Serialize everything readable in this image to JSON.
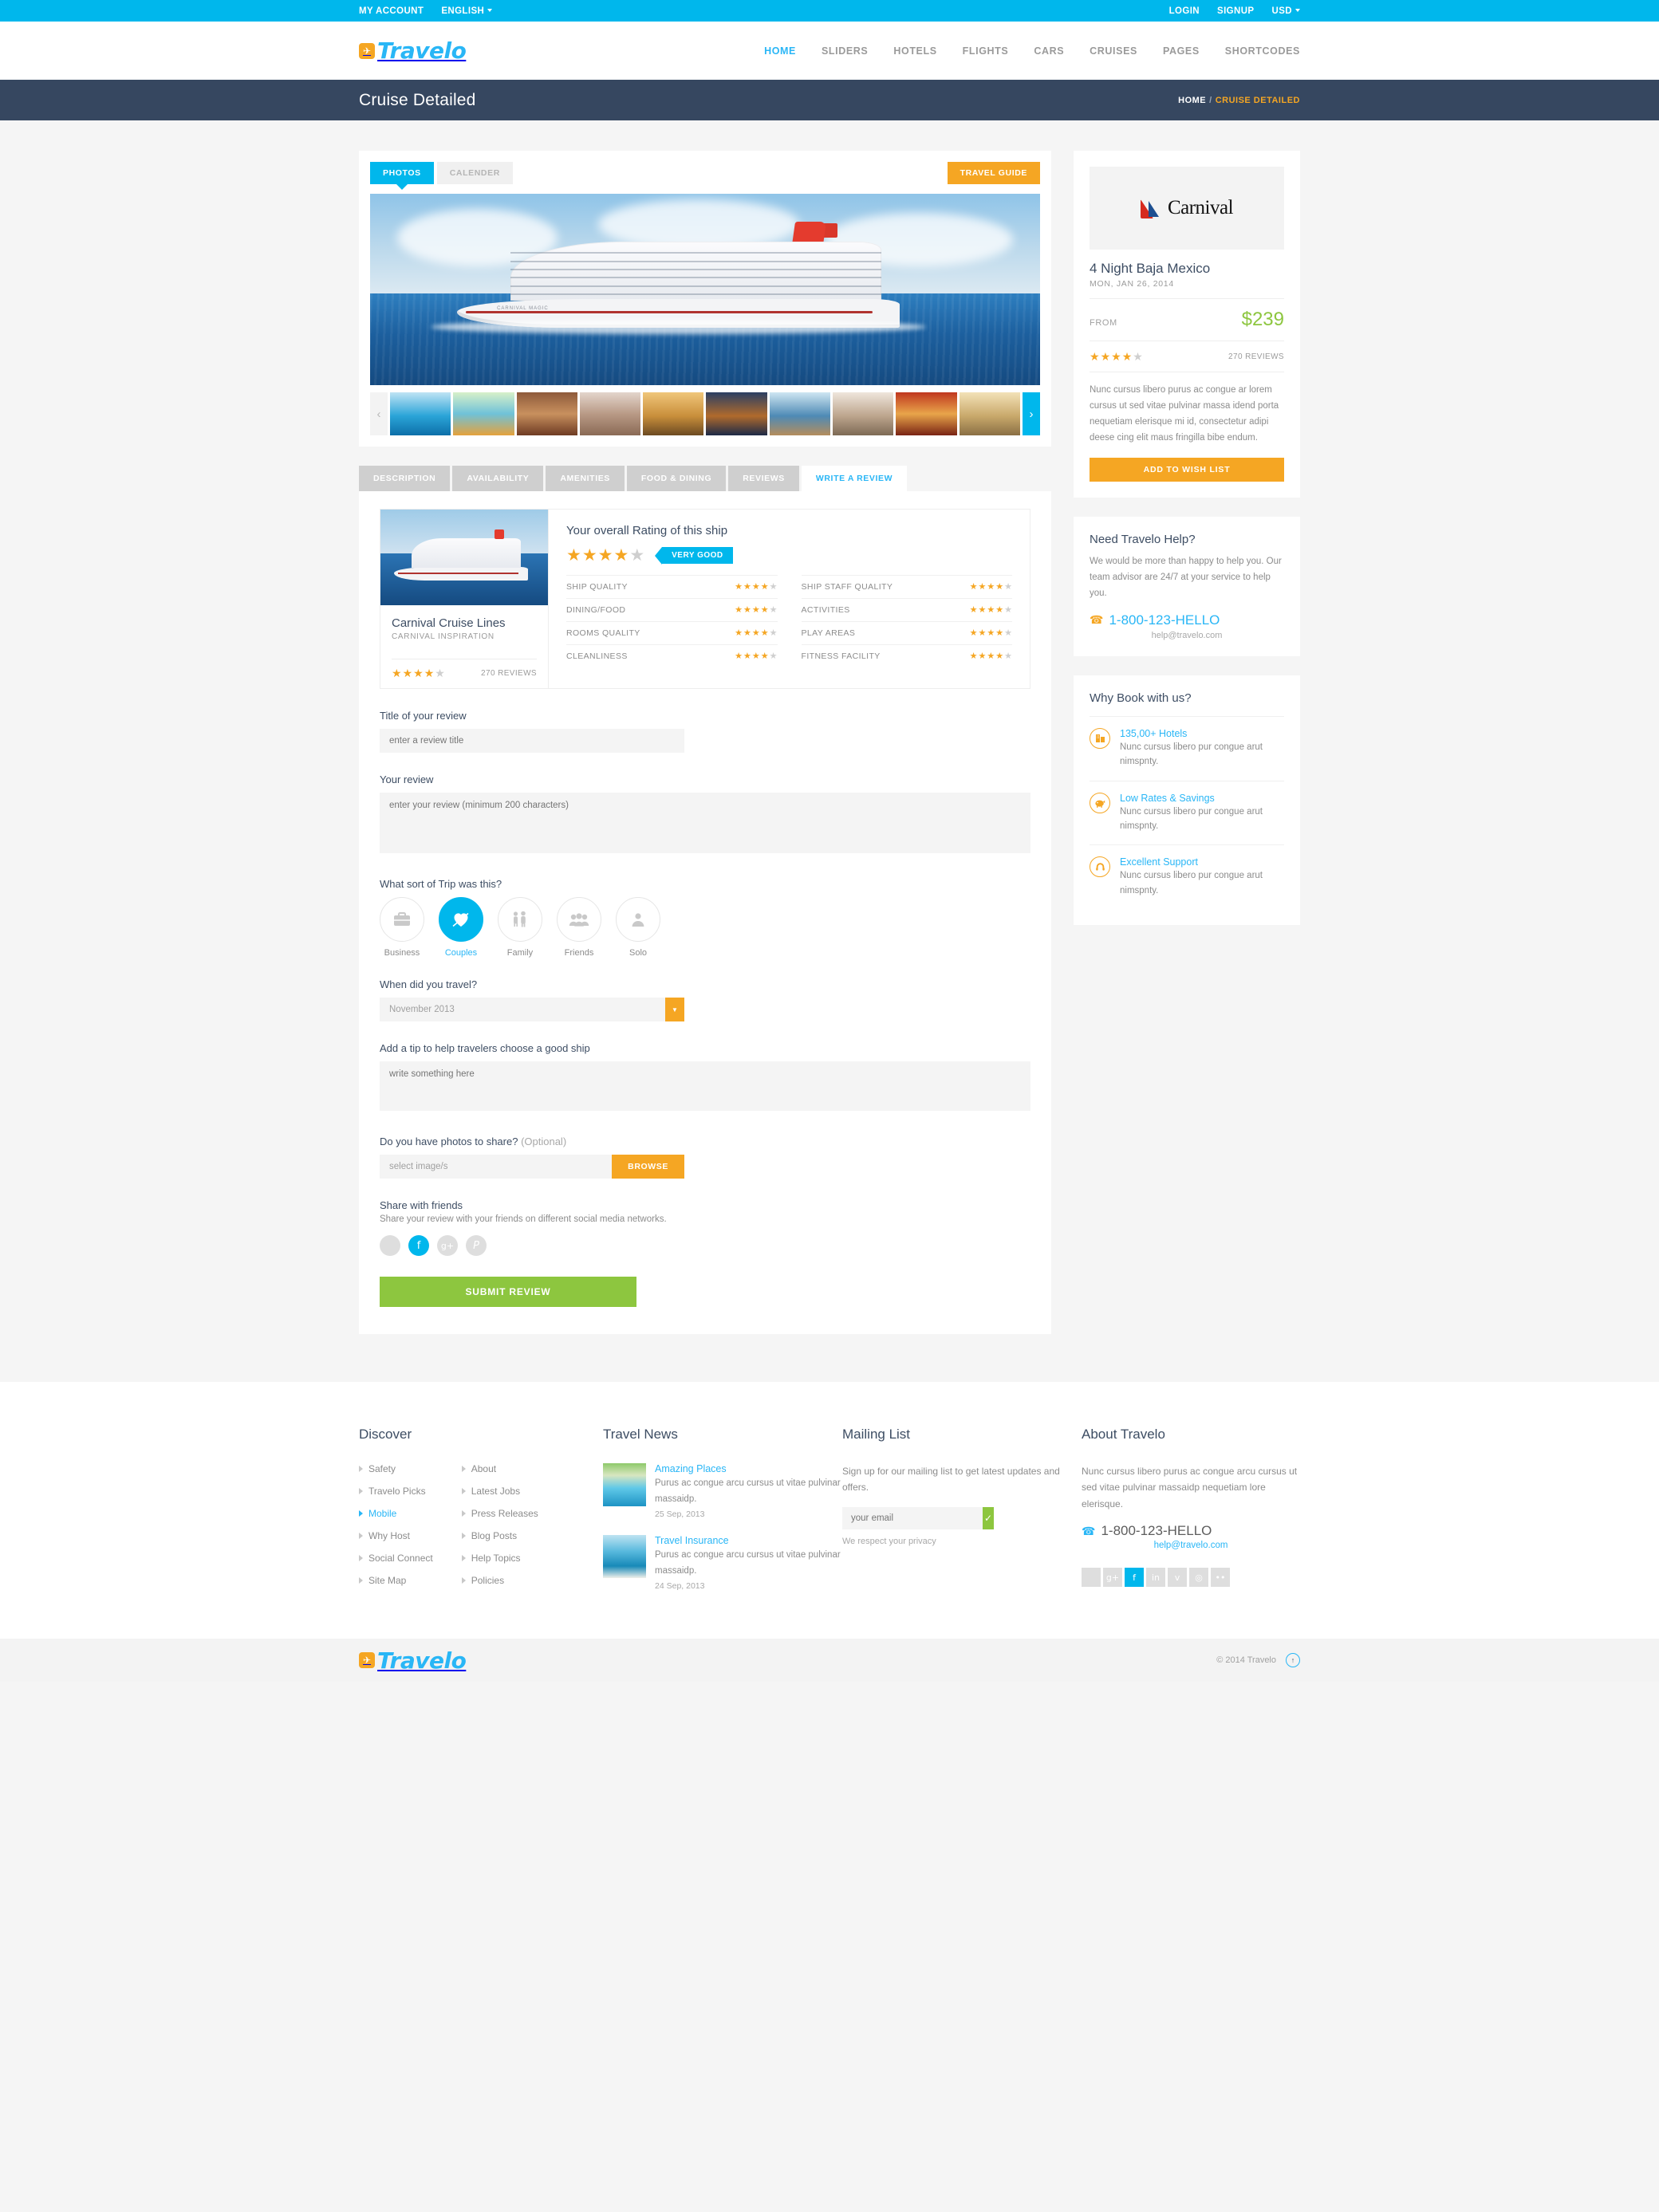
{
  "topbar": {
    "left": [
      {
        "label": "MY ACCOUNT",
        "caret": false
      },
      {
        "label": "ENGLISH",
        "caret": true
      }
    ],
    "right": [
      {
        "label": "LOGIN",
        "caret": false
      },
      {
        "label": "SIGNUP",
        "caret": false
      },
      {
        "label": "USD",
        "caret": true
      }
    ]
  },
  "brand": {
    "name": "Travelo",
    "icon": "plane-icon"
  },
  "nav": [
    {
      "label": "HOME",
      "active": true
    },
    {
      "label": "SLIDERS",
      "active": false
    },
    {
      "label": "HOTELS",
      "active": false
    },
    {
      "label": "FLIGHTS",
      "active": false
    },
    {
      "label": "CARS",
      "active": false
    },
    {
      "label": "CRUISES",
      "active": false
    },
    {
      "label": "PAGES",
      "active": false
    },
    {
      "label": "SHORTCODES",
      "active": false
    }
  ],
  "pageheader": {
    "title": "Cruise Detailed",
    "crumb_home": "HOME",
    "crumb_sep": "/",
    "crumb_current": "CRUISE DETAILED"
  },
  "gallery": {
    "tabs": [
      {
        "label": "PHOTOS",
        "active": true
      },
      {
        "label": "CALENDER",
        "active": false
      }
    ],
    "guide_button": "TRAVEL GUIDE",
    "prev_icon": "chevron-left-icon",
    "next_icon": "chevron-right-icon",
    "thumb_count": 10
  },
  "tabs": [
    {
      "label": "DESCRIPTION",
      "active": false
    },
    {
      "label": "AVAILABILITY",
      "active": false
    },
    {
      "label": "AMENITIES",
      "active": false
    },
    {
      "label": "FOOD & DINING",
      "active": false
    },
    {
      "label": "REVIEWS",
      "active": false
    },
    {
      "label": "WRITE A REVIEW",
      "active": true
    }
  ],
  "review_summary": {
    "ship_name": "Carnival Cruise Lines",
    "ship_sub": "CARNIVAL INSPIRATION",
    "ship_stars": 4,
    "ship_reviews": "270 REVIEWS",
    "overall_title": "Your overall Rating of this ship",
    "overall_stars": 4,
    "overall_badge": "VERY GOOD",
    "criteria_left": [
      {
        "label": "SHIP QUALITY",
        "stars": 4
      },
      {
        "label": "DINING/FOOD",
        "stars": 4
      },
      {
        "label": "ROOMS QUALITY",
        "stars": 4
      },
      {
        "label": "CLEANLINESS",
        "stars": 4
      }
    ],
    "criteria_right": [
      {
        "label": "SHIP STAFF QUALITY",
        "stars": 4
      },
      {
        "label": "ACTIVITIES",
        "stars": 4
      },
      {
        "label": "PLAY AREAS",
        "stars": 4
      },
      {
        "label": "FITNESS FACILITY",
        "stars": 4
      }
    ]
  },
  "form": {
    "title_label": "Title of your review",
    "title_placeholder": "enter a review title",
    "title_value": "",
    "review_label": "Your review",
    "review_placeholder": "enter your review (minimum 200 characters)",
    "review_value": "",
    "trip_label": "What sort of Trip was this?",
    "trip_options": [
      {
        "label": "Business",
        "icon": "briefcase-icon",
        "glyph": "ὋC",
        "active": false
      },
      {
        "label": "Couples",
        "icon": "heart-arrow-icon",
        "glyph": "♥",
        "active": true
      },
      {
        "label": "Family",
        "icon": "family-icon",
        "glyph": "὆A",
        "active": false
      },
      {
        "label": "Friends",
        "icon": "friends-icon",
        "glyph": "὆5",
        "active": false
      },
      {
        "label": "Solo",
        "icon": "person-icon",
        "glyph": "὆4",
        "active": false
      }
    ],
    "when_label": "When did you travel?",
    "when_value": "November 2013",
    "when_caret_icon": "caret-down-icon",
    "tip_label": "Add a tip to help travelers choose a good ship",
    "tip_placeholder": "write something here",
    "tip_value": "",
    "photos_label": "Do you have photos to share?",
    "photos_optional": " (Optional)",
    "photos_placeholder": "select image/s",
    "browse_button": "BROWSE",
    "share_title": "Share with friends",
    "share_sub": "Share your review with your friends on different social media networks.",
    "share_icons": [
      {
        "name": "twitter-icon",
        "glyph": "ᴡ",
        "active": false
      },
      {
        "name": "facebook-icon",
        "glyph": "f",
        "active": true
      },
      {
        "name": "google-plus-icon",
        "glyph": "g+",
        "active": false
      },
      {
        "name": "pinterest-icon",
        "glyph": "P",
        "active": false
      }
    ],
    "submit_button": "SUBMIT REVIEW"
  },
  "sidebar": {
    "brand_logo": "Carnival",
    "cruise_title": "4 Night Baja Mexico",
    "cruise_date": "MON, JAN 26, 2014",
    "from_label": "FROM",
    "price": "$239",
    "stars": 4,
    "reviews": "270 REVIEWS",
    "description": "Nunc cursus libero purus ac congue ar lorem cursus ut sed vitae pulvinar massa idend porta nequetiam elerisque mi id, consectetur adipi deese cing elit maus fringilla bibe endum.",
    "wish_button": "ADD TO WISH LIST",
    "help_title": "Need Travelo Help?",
    "help_text": "We would be more than happy to help you. Our team advisor are 24/7 at your service to help you.",
    "help_phone": "1-800-123-HELLO",
    "help_email": "help@travelo.com",
    "why_title": "Why Book with us?",
    "why_items": [
      {
        "heading": "135,00+ Hotels",
        "text": "Nunc cursus libero pur congue arut nimspnty.",
        "icon": "building-icon",
        "glyph": "Ἶ2"
      },
      {
        "heading": "Low Rates & Savings",
        "text": "Nunc cursus libero pur congue arut nimspnty.",
        "icon": "piggy-bank-icon",
        "glyph": "ὁ6"
      },
      {
        "heading": "Excellent Support",
        "text": "Nunc cursus libero pur congue arut nimspnty.",
        "icon": "headset-icon",
        "glyph": "☎"
      }
    ]
  },
  "footer": {
    "discover_title": "Discover",
    "discover_col1": [
      {
        "label": "Safety",
        "active": false
      },
      {
        "label": "Travelo Picks",
        "active": false
      },
      {
        "label": "Mobile",
        "active": true
      },
      {
        "label": "Why Host",
        "active": false
      },
      {
        "label": "Social Connect",
        "active": false
      },
      {
        "label": "Site Map",
        "active": false
      }
    ],
    "discover_col2": [
      {
        "label": "About",
        "active": false
      },
      {
        "label": "Latest Jobs",
        "active": false
      },
      {
        "label": "Press Releases",
        "active": false
      },
      {
        "label": "Blog Posts",
        "active": false
      },
      {
        "label": "Help Topics",
        "active": false
      },
      {
        "label": "Policies",
        "active": false
      }
    ],
    "news_title": "Travel News",
    "news": [
      {
        "heading": "Amazing Places",
        "text": "Purus ac congue arcu cursus ut vitae pulvinar massaidp.",
        "date": "25 Sep, 2013"
      },
      {
        "heading": "Travel Insurance",
        "text": "Purus ac congue arcu cursus ut vitae pulvinar massaidp.",
        "date": "24 Sep, 2013"
      }
    ],
    "mail_title": "Mailing List",
    "mail_text": "Sign up for our mailing list to get latest updates and offers.",
    "mail_placeholder": "your email",
    "mail_value": "",
    "mail_ok_icon": "check-icon",
    "mail_note": "We respect your privacy",
    "about_title": "About Travelo",
    "about_text": "Nunc cursus libero purus ac congue arcu cursus ut sed vitae pulvinar massaidp nequetiam lore elerisque.",
    "about_phone": "1-800-123-HELLO",
    "about_email": "help@travelo.com",
    "socials": [
      {
        "name": "twitter-icon",
        "glyph": "ᴡ",
        "active": false
      },
      {
        "name": "google-plus-icon",
        "glyph": "g+",
        "active": false
      },
      {
        "name": "facebook-icon",
        "glyph": "f",
        "active": true
      },
      {
        "name": "linkedin-icon",
        "glyph": "in",
        "active": false
      },
      {
        "name": "vimeo-icon",
        "glyph": "v",
        "active": false
      },
      {
        "name": "dribbble-icon",
        "glyph": "◎",
        "active": false
      },
      {
        "name": "flickr-icon",
        "glyph": "••",
        "active": false
      }
    ],
    "copyright": "© 2014 Travelo",
    "totop_icon": "arrow-up-icon"
  },
  "colors": {
    "accent_blue": "#00b7ec",
    "orange": "#f5a623",
    "green": "#8dc63f",
    "dark_slate": "#364760"
  }
}
